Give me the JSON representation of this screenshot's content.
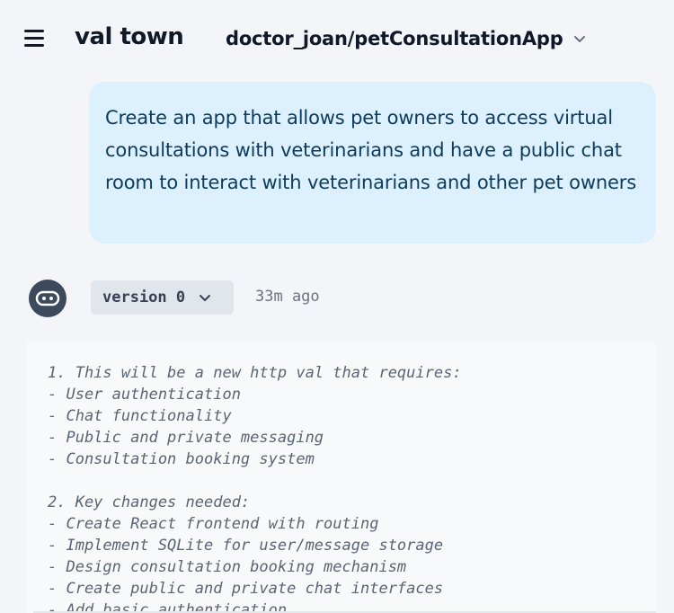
{
  "header": {
    "logo": "val town",
    "project_name": "doctor_joan/petConsultationApp"
  },
  "user_message": {
    "text": "Create an app that allows pet owners to access virtual consultations with veterinarians and have a public chat room to interact with veterinarians and other pet owners"
  },
  "assistant": {
    "version_label": "version 0",
    "timestamp": "33m ago",
    "code_lines": [
      "1. This will be a new http val that requires:",
      "- User authentication",
      "- Chat functionality",
      "- Public and private messaging",
      "- Consultation booking system",
      "",
      "2. Key changes needed:",
      "- Create React frontend with routing",
      "- Implement SQLite for user/message storage",
      "- Design consultation booking mechanism",
      "- Create public and private chat interfaces",
      "- Add basic authentication"
    ]
  },
  "icons": {
    "menu": "hamburger-menu-icon",
    "project_dropdown": "chevron-down-icon",
    "avatar": "robot-icon",
    "version_dropdown": "chevron-down-icon"
  },
  "colors": {
    "background": "#f3f5f9",
    "prompt_bubble": "#dcf0fd",
    "prompt_text": "#0b3b5e",
    "avatar_bg": "#3d4a5c",
    "version_bg": "#e1e6ed"
  }
}
